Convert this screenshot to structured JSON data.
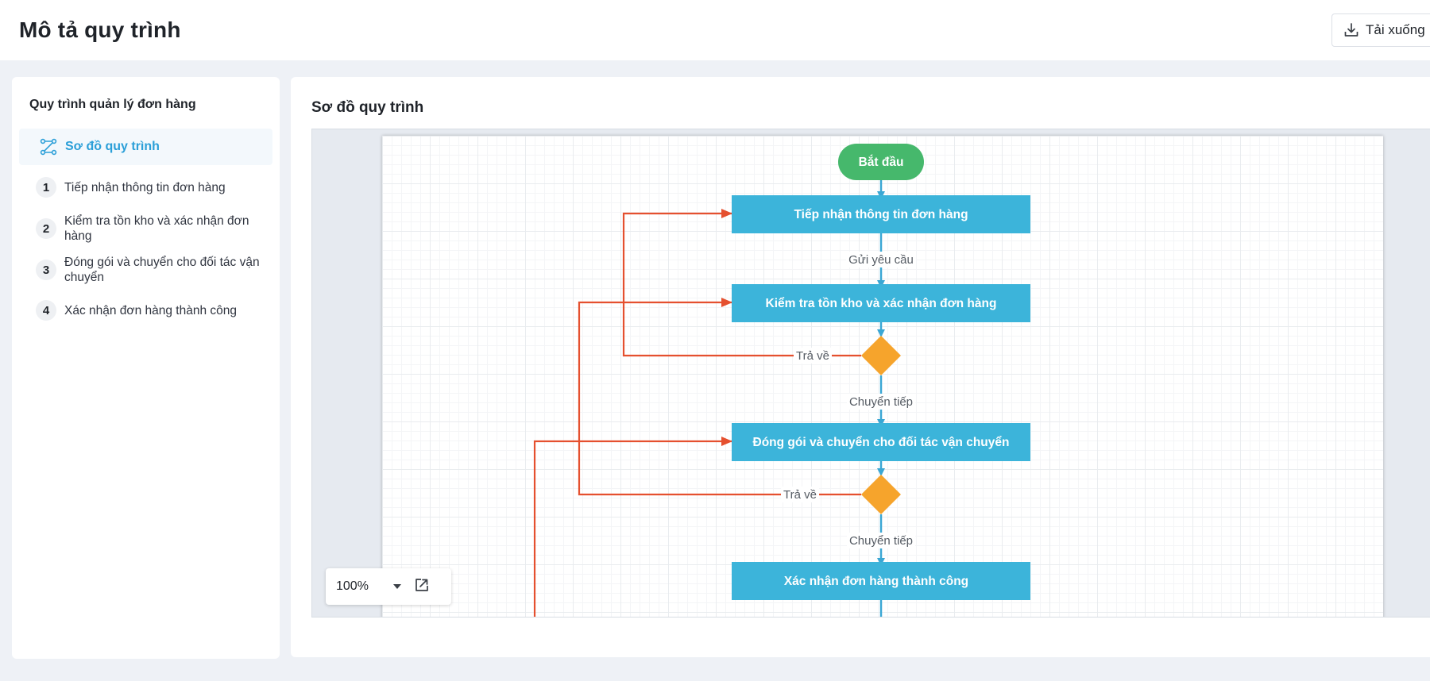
{
  "header": {
    "title": "Mô tả quy trình",
    "download_label": "Tải xuống"
  },
  "sidebar": {
    "title": "Quy trình quản lý đơn hàng",
    "active_item": "Sơ đồ quy trình",
    "steps": [
      {
        "num": "1",
        "label": "Tiếp nhận thông tin đơn hàng"
      },
      {
        "num": "2",
        "label": "Kiểm tra tồn kho và xác nhận đơn hàng"
      },
      {
        "num": "3",
        "label": "Đóng gói và chuyển cho đối tác vận chuyển"
      },
      {
        "num": "4",
        "label": "Xác nhận đơn hàng thành công"
      }
    ]
  },
  "main": {
    "title": "Sơ đồ quy trình"
  },
  "diagram": {
    "start": "Bắt đầu",
    "node1": "Tiếp nhận thông tin đơn hàng",
    "node2": "Kiểm tra tồn kho và xác nhận đơn hàng",
    "node3": "Đóng gói và chuyển cho đối tác vận chuyển",
    "node4": "Xác nhận đơn hàng thành công",
    "edge_request": "Gửi yêu cầu",
    "edge_return_1": "Trả về",
    "edge_forward_1": "Chuyển tiếp",
    "edge_return_2": "Trả về",
    "edge_forward_2": "Chuyển tiếp"
  },
  "zoom": {
    "level": "100%"
  },
  "colors": {
    "accent": "#2b9fd8",
    "process": "#3cb4da",
    "start": "#46b86c",
    "decision": "#f6a42c",
    "return_edge": "#e5502f",
    "flow_edge": "#3ba7d4"
  },
  "icons": {
    "download": "download-icon",
    "diagram": "flow-diagram-icon",
    "caret": "caret-down-icon",
    "export": "export-icon"
  }
}
